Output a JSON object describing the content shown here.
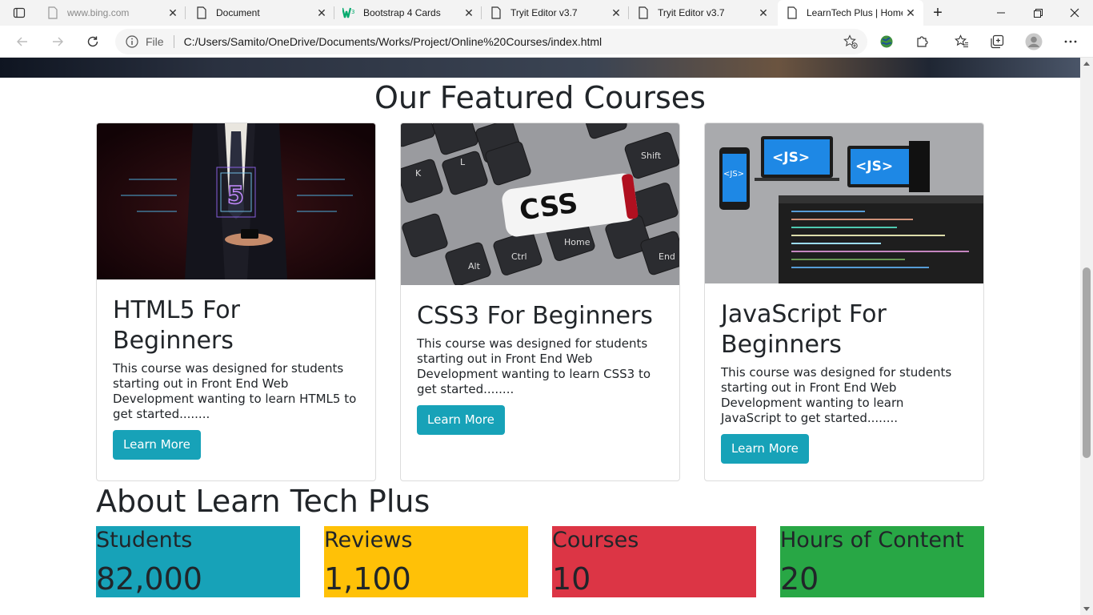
{
  "browser": {
    "tabs": [
      {
        "title": "www.bing.com",
        "icon": "page-icon",
        "faded": true
      },
      {
        "title": "Document",
        "icon": "page-icon",
        "faded": false
      },
      {
        "title": "Bootstrap 4 Cards",
        "icon": "w3schools-icon",
        "faded": false
      },
      {
        "title": "Tryit Editor v3.7",
        "icon": "page-icon",
        "faded": false
      },
      {
        "title": "Tryit Editor v3.7",
        "icon": "page-icon",
        "faded": false
      },
      {
        "title": "LearnTech Plus | Home",
        "icon": "page-icon",
        "faded": false,
        "active": true
      }
    ],
    "address": {
      "scheme_label": "File",
      "url": "C:/Users/Samito/OneDrive/Documents/Works/Project/Online%20Courses/index.html"
    },
    "colors": {
      "accent_green": "#2e8b57"
    }
  },
  "page": {
    "featured_title": "Our Featured Courses",
    "courses": [
      {
        "title": "HTML5 For Beginners",
        "description": "This course was designed for students starting out in Front End Web Development wanting to learn HTML5 to get started........",
        "button": "Learn More",
        "image": "html5-businessman-hologram"
      },
      {
        "title": "CSS3 For Beginners",
        "description": "This course was designed for students starting out in Front End Web Development wanting to learn CSS3 to get started........",
        "button": "Learn More",
        "image": "css-usb-keyboard"
      },
      {
        "title": "JavaScript For Beginners",
        "description": "This course was designed for students starting out in Front End Web Development wanting to learn JavaScript to get started........",
        "button": "Learn More",
        "image": "js-devices-code"
      }
    ],
    "about_title": "About Learn Tech Plus",
    "stats": [
      {
        "label": "Students",
        "value": "82,000",
        "color": "#17a2b8"
      },
      {
        "label": "Reviews",
        "value": "1,100",
        "color": "#ffc107"
      },
      {
        "label": "Courses",
        "value": "10",
        "color": "#dc3545"
      },
      {
        "label": "Hours of Content",
        "value": "20",
        "color": "#28a745"
      }
    ],
    "button_color": "#17a2b8"
  }
}
